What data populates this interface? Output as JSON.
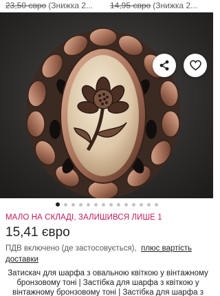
{
  "related": [
    {
      "old_price": "23,50 євро",
      "discount": "(Знижка 2..."
    },
    {
      "old_price": "14,95 євро",
      "discount": "(Знижка 2..."
    }
  ],
  "gallery": {
    "image_subject": "brooch",
    "slide_count": 14,
    "active_index": 0
  },
  "actions": {
    "share_icon": "share-icon",
    "favorite_icon": "heart-icon"
  },
  "listing": {
    "stock_notice": "МАЛО НА СКЛАДІ, ЗАЛИШИВСЯ ЛИШЕ 1",
    "price": "15,41 євро",
    "vat_text": "ПДВ включено (де застосовується),",
    "vat_link_line1": "плюс вартість",
    "vat_link_line2": "доставки",
    "description": "Затискач для шарфа з овальною квіткою у вінтажному бронзовому тоні | Застібка для шарфа з квіткою у вінтажному бронзовому тоні | Застібка для шарфа з"
  },
  "colors": {
    "stock_accent": "#c2185b",
    "photo_background": "#2b2a29",
    "metal": "#b88468"
  }
}
